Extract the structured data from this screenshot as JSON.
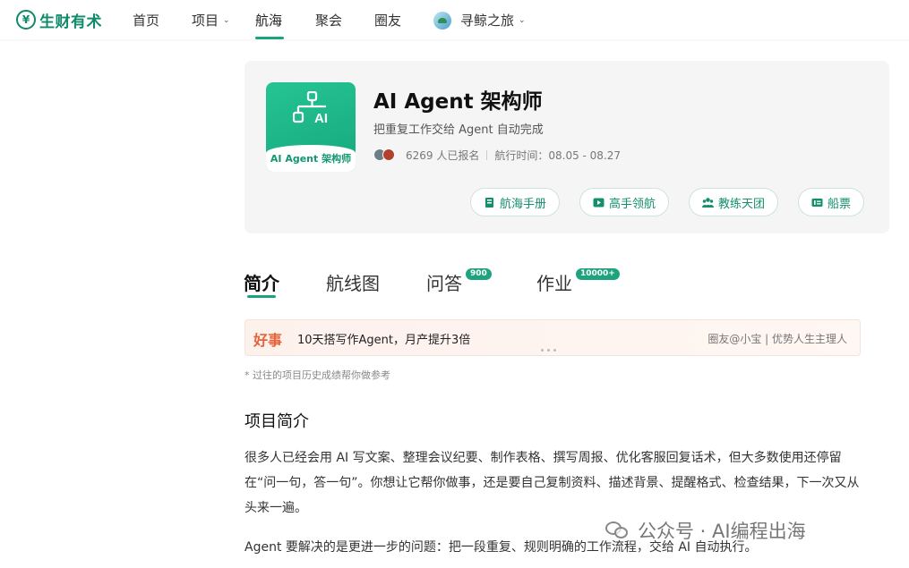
{
  "brand": {
    "name": "生财有术",
    "mark": "¥"
  },
  "nav": {
    "items": [
      {
        "label": "首页"
      },
      {
        "label": "项目",
        "chevron": true
      },
      {
        "label": "航海",
        "active": true
      },
      {
        "label": "聚会"
      },
      {
        "label": "圈友"
      },
      {
        "label": "寻鲸之旅",
        "chevron": true,
        "icon": "whale-icon"
      }
    ]
  },
  "project": {
    "cover_label": "AI Agent 架构师",
    "cover_icon_text": "AI",
    "title": "AI Agent 架构师",
    "subtitle": "把重复工作交给 Agent 自动完成",
    "signups": "6269 人已报名",
    "sail_time": "航行时间：08.05 - 08.27",
    "buttons": [
      {
        "label": "航海手册",
        "icon": "book-icon"
      },
      {
        "label": "高手领航",
        "icon": "play-icon"
      },
      {
        "label": "教练天团",
        "icon": "team-icon"
      },
      {
        "label": "船票",
        "icon": "ticket-icon"
      }
    ]
  },
  "tabs": [
    {
      "label": "简介",
      "active": true
    },
    {
      "label": "航线图"
    },
    {
      "label": "问答",
      "badge": "900"
    },
    {
      "label": "作业",
      "badge": "10000+"
    }
  ],
  "news": {
    "tag": "好事",
    "text": "10天搭写作Agent，月产提升3倍",
    "author": "圈友@小宝 | 优势人生主理人"
  },
  "note": "* 过往的项目历史成绩帮你做参考",
  "intro": {
    "title": "项目简介",
    "para1": "很多人已经会用 AI 写文案、整理会议纪要、制作表格、撰写周报、优化客服回复话术，但大多数使用还停留在“问一句，答一句”。你想让它帮你做事，还是要自己复制资料、描述背景、提醒格式、检查结果，下一次又从头来一遍。",
    "para2": "Agent 要解决的是更进一步的问题：把一段重复、规则明确的工作流程，交给 AI 自动执行。"
  },
  "watermark": "公众号 · AI编程出海",
  "colors": {
    "brand_green": "#1aa37f",
    "news_orange": "#e8623a"
  }
}
